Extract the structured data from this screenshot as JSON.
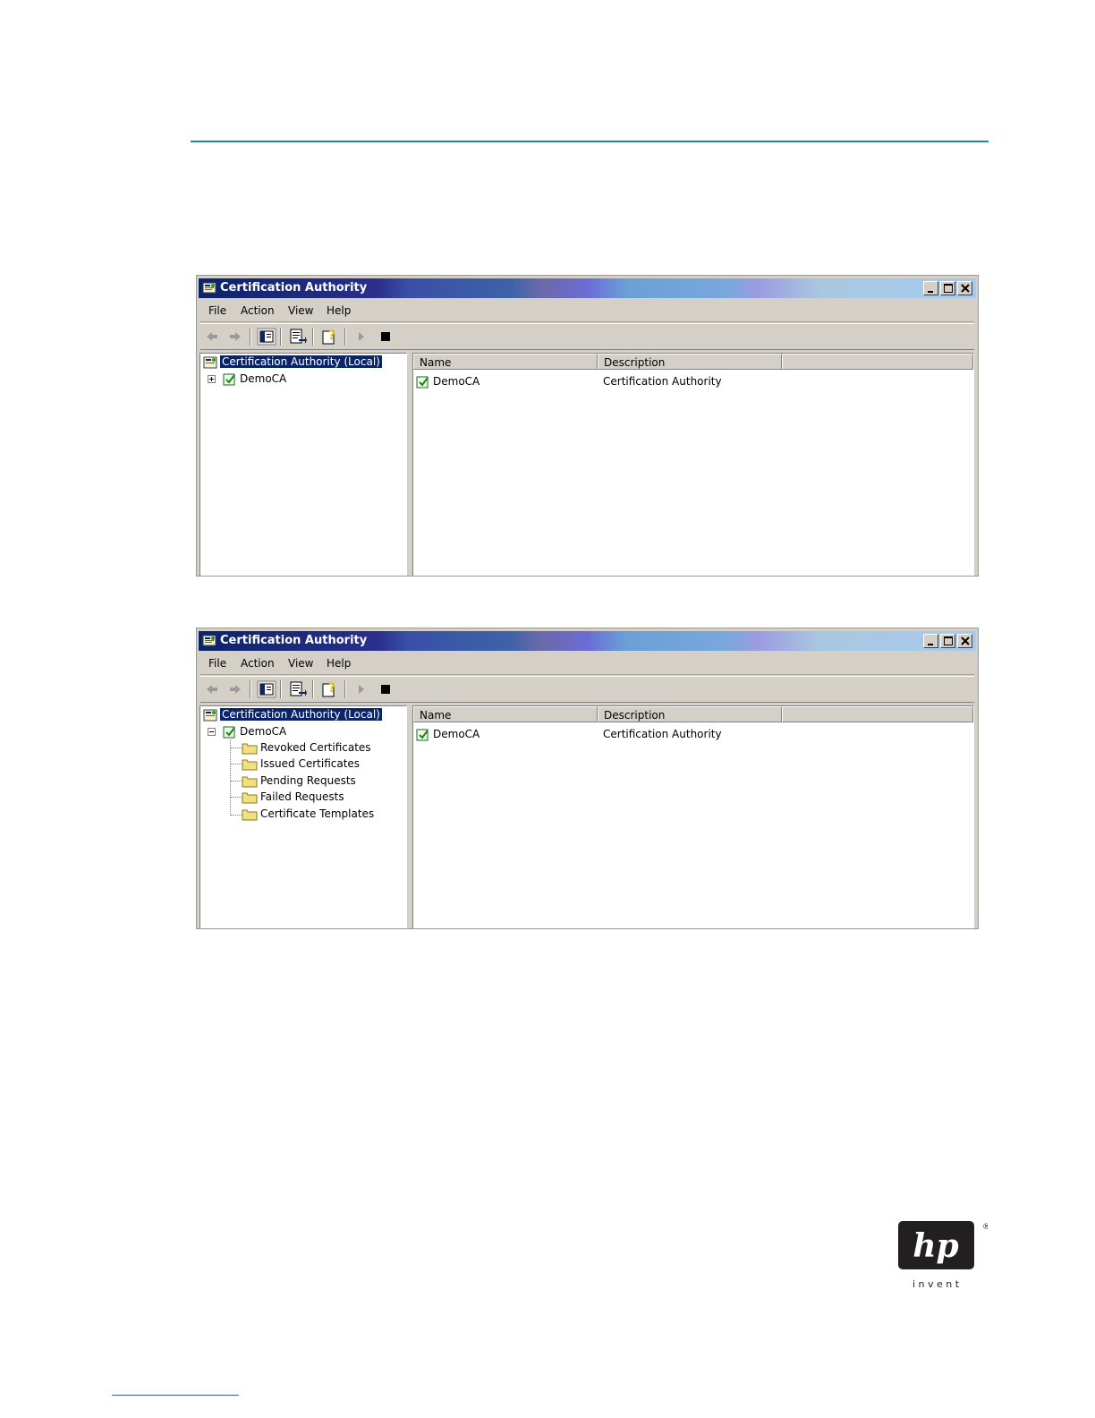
{
  "windows": [
    {
      "title": "Certification Authority",
      "menu": [
        "File",
        "Action",
        "View",
        "Help"
      ],
      "tree": {
        "root": "Certification Authority (Local)",
        "node": "DemoCA",
        "expanded": false,
        "children": []
      },
      "list": {
        "columns": [
          "Name",
          "Description"
        ],
        "rows": [
          {
            "name": "DemoCA",
            "description": "Certification Authority"
          }
        ]
      }
    },
    {
      "title": "Certification Authority",
      "menu": [
        "File",
        "Action",
        "View",
        "Help"
      ],
      "tree": {
        "root": "Certification Authority (Local)",
        "node": "DemoCA",
        "expanded": true,
        "children": [
          "Revoked Certificates",
          "Issued Certificates",
          "Pending Requests",
          "Failed Requests",
          "Certificate Templates"
        ]
      },
      "list": {
        "columns": [
          "Name",
          "Description"
        ],
        "rows": [
          {
            "name": "DemoCA",
            "description": "Certification Authority"
          }
        ]
      }
    }
  ],
  "icons": {
    "title": "certificate-authority-icon",
    "toolbar": [
      "back-arrow-icon",
      "forward-arrow-icon",
      "show-hide-tree-icon",
      "export-list-icon",
      "help-icon",
      "start-service-icon",
      "stop-service-icon"
    ],
    "folder": "folder-icon",
    "ca": "ca-certificate-icon"
  },
  "colors": {
    "title_dark": "#0a246a",
    "title_light": "#a6caf0",
    "accent_rule": "#1e8a9c",
    "selection": "#0a246a"
  },
  "logo": {
    "text": "hp",
    "tagline": "i n v e n t",
    "reg": "®"
  }
}
